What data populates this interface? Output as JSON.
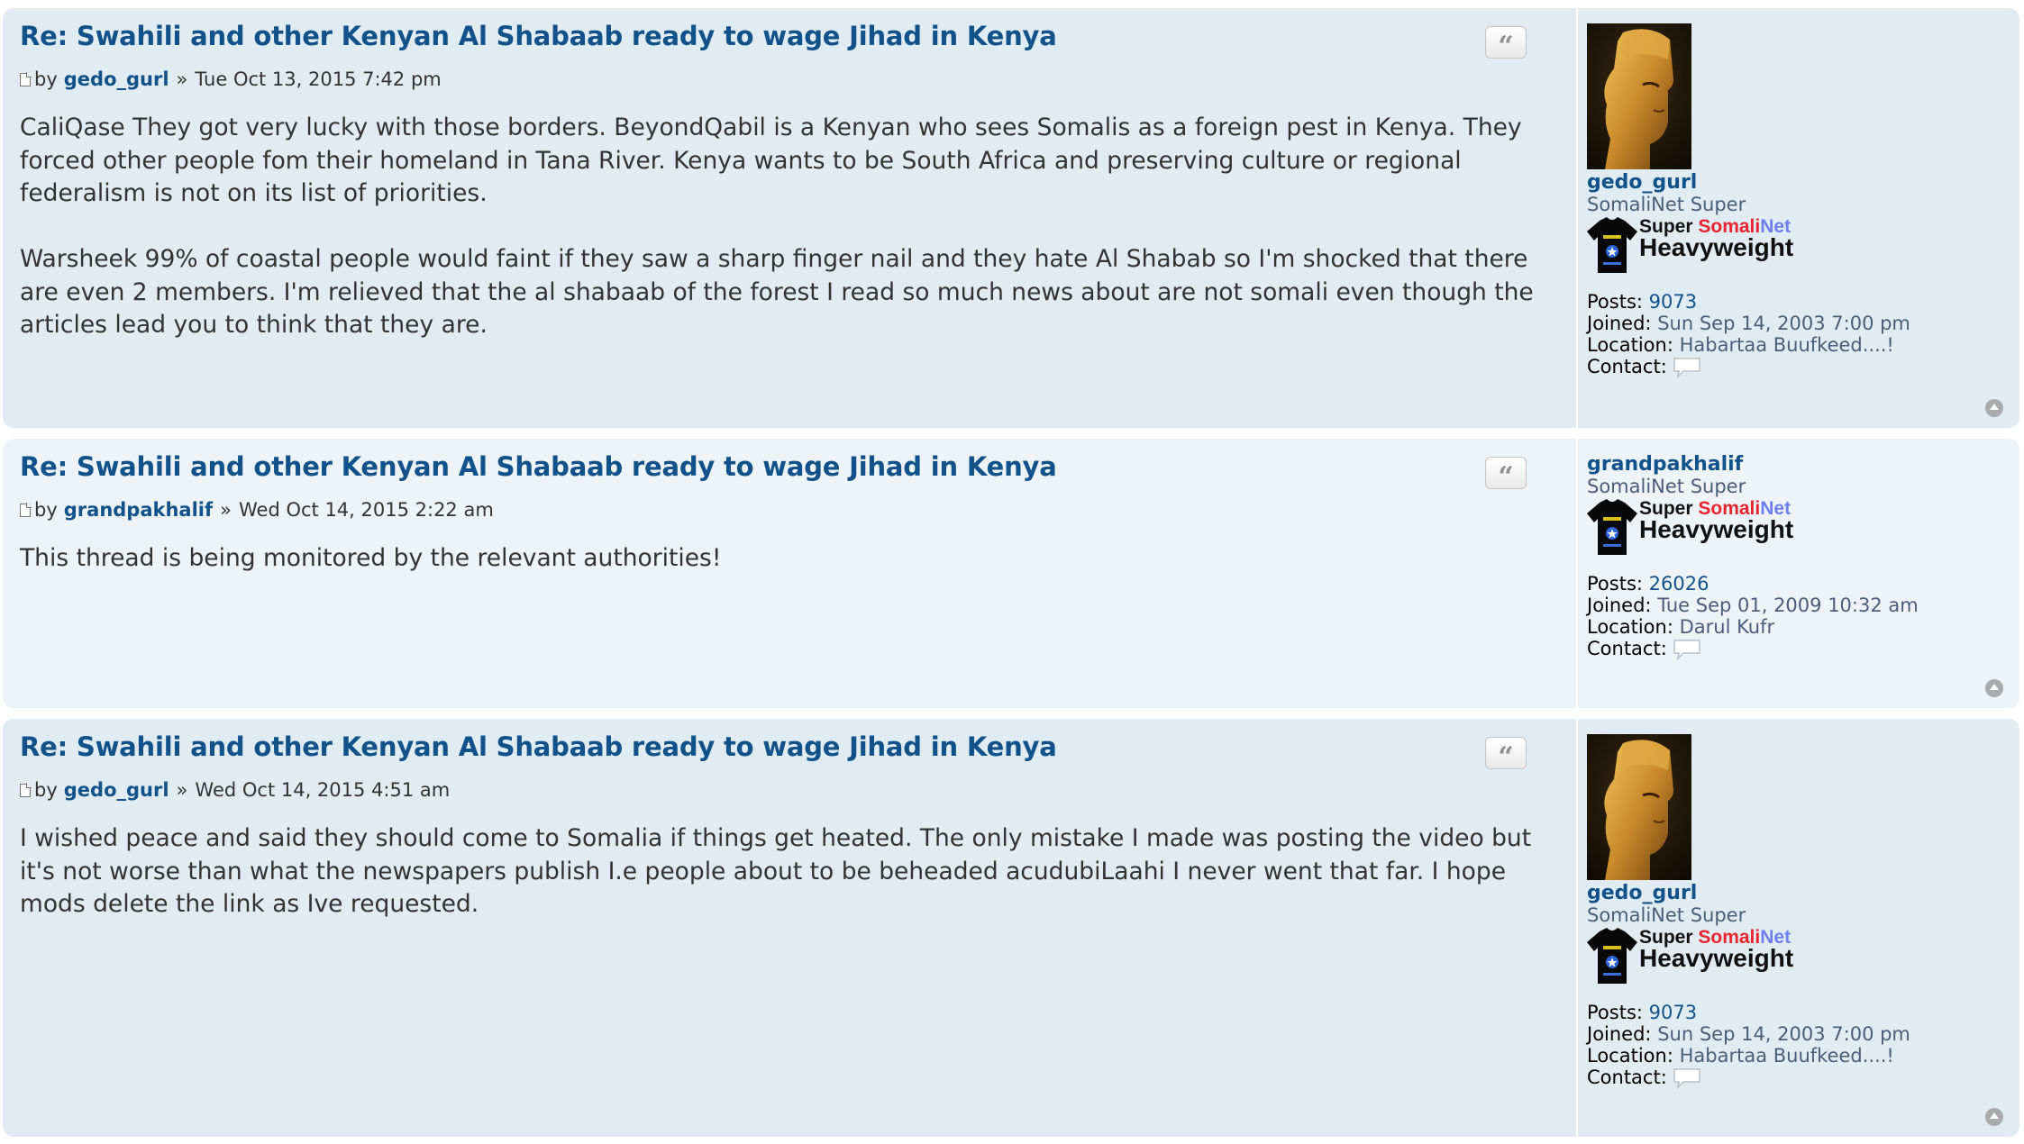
{
  "posts": [
    {
      "title": "Re: Swahili and other Kenyan Al Shabaab ready to wage Jihad in Kenya",
      "by": "by",
      "author": "gedo_gurl",
      "sep": "»",
      "date": "Tue Oct 13, 2015 7:42 pm",
      "paragraphs": [
        "CaliQase They got very lucky with those borders. BeyondQabil is a Kenyan who sees Somalis as a foreign pest in Kenya. They forced other people fom their homeland in Tana River. Kenya wants to be South Africa and preserving culture or regional federalism is not on its list of priorities.",
        "Warsheek 99% of coastal people would faint if they saw a sharp finger nail and they hate Al Shabab so I'm shocked that there are even 2 members. I'm relieved that the al shabaab of the forest I read so much news about are not somali even though the articles lead you to think that they are."
      ],
      "quote_glyph": "“",
      "profile": {
        "has_avatar": true,
        "username": "gedo_gurl",
        "rank": "SomaliNet Super",
        "badge_line1": [
          "Super ",
          "Somali",
          "Net"
        ],
        "badge_line2": "Heavyweight",
        "posts_label": "Posts:",
        "posts": "9073",
        "joined_label": "Joined:",
        "joined": "Sun Sep 14, 2003 7:00 pm",
        "location_label": "Location:",
        "location": "Habartaa Buufkeed....!",
        "contact_label": "Contact:"
      }
    },
    {
      "title": "Re: Swahili and other Kenyan Al Shabaab ready to wage Jihad in Kenya",
      "by": "by",
      "author": "grandpakhalif",
      "sep": "»",
      "date": "Wed Oct 14, 2015 2:22 am",
      "paragraphs": [
        "This thread is being monitored by the relevant authorities!"
      ],
      "quote_glyph": "“",
      "profile": {
        "has_avatar": false,
        "username": "grandpakhalif",
        "rank": "SomaliNet Super",
        "badge_line1": [
          "Super ",
          "Somali",
          "Net"
        ],
        "badge_line2": "Heavyweight",
        "posts_label": "Posts:",
        "posts": "26026",
        "joined_label": "Joined:",
        "joined": "Tue Sep 01, 2009 10:32 am",
        "location_label": "Location:",
        "location": "Darul Kufr",
        "contact_label": "Contact:"
      }
    },
    {
      "title": "Re: Swahili and other Kenyan Al Shabaab ready to wage Jihad in Kenya",
      "by": "by",
      "author": "gedo_gurl",
      "sep": "»",
      "date": "Wed Oct 14, 2015 4:51 am",
      "paragraphs": [
        "I wished peace and said they should come to Somalia if things get heated. The only mistake I made was posting the video but it's not worse than what the newspapers publish I.e people about to be beheaded acudubiLaahi I never went that far. I hope mods delete the link as Ive requested."
      ],
      "quote_glyph": "“",
      "profile": {
        "has_avatar": true,
        "username": "gedo_gurl",
        "rank": "SomaliNet Super",
        "badge_line1": [
          "Super ",
          "Somali",
          "Net"
        ],
        "badge_line2": "Heavyweight",
        "posts_label": "Posts:",
        "posts": "9073",
        "joined_label": "Joined:",
        "joined": "Sun Sep 14, 2003 7:00 pm",
        "location_label": "Location:",
        "location": "Habartaa Buufkeed....!",
        "contact_label": "Contact:"
      }
    }
  ],
  "colors": {
    "post_bg_odd": "#e1ebf2",
    "post_bg_even": "#eef3f7",
    "link": "#105289",
    "text": "#333333",
    "badge_somali": "#e8242f",
    "badge_net": "#6f7ff0"
  },
  "icons": {
    "post": "post-icon",
    "quote": "quote-icon",
    "contact": "speech-bubble-icon",
    "top": "back-to-top-icon"
  }
}
